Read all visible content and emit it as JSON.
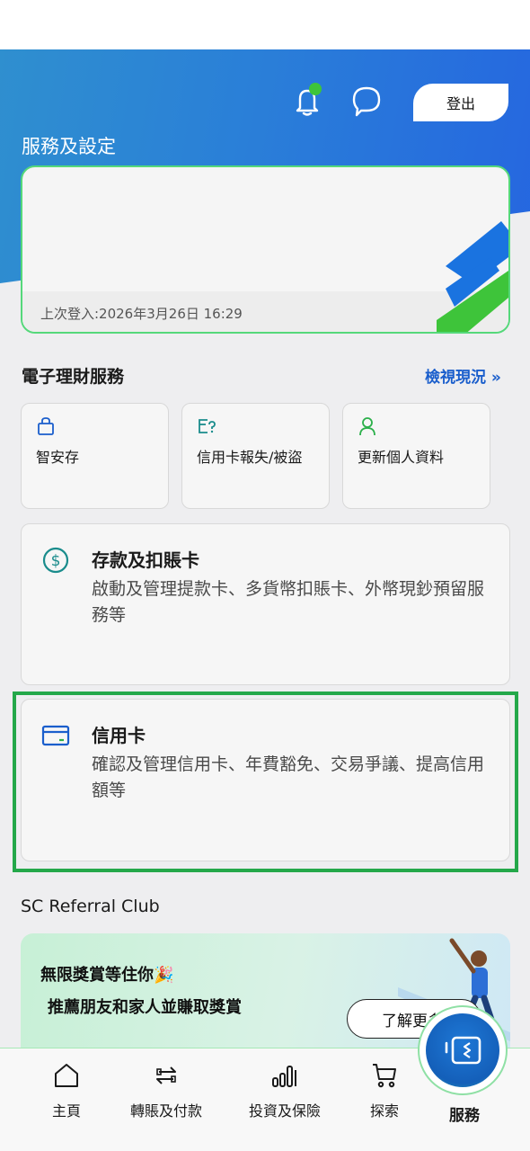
{
  "header": {
    "title": "服務及設定",
    "logout_label": "登出",
    "icons": [
      "bell-icon",
      "chat-icon"
    ]
  },
  "account_card": {
    "last_login": "上次登入:2026年3月26日 16:29"
  },
  "ebanking": {
    "section_title": "電子理財服務",
    "view_link": "檢視現況 »",
    "tiles": [
      {
        "label": "智安存",
        "icon": "lock-bag-icon"
      },
      {
        "label": "信用卡報失/被盜",
        "icon": "card-question-icon"
      },
      {
        "label": "更新個人資料",
        "icon": "person-icon"
      }
    ]
  },
  "services": [
    {
      "title": "存款及扣賬卡",
      "description": "啟動及管理提款卡、多貨幣扣賬卡、外幣現鈔預留服務等",
      "icon": "dollar-circle-icon"
    },
    {
      "title": "信用卡",
      "description": "確認及管理信用卡、年費豁免、交易爭議、提高信用額等",
      "icon": "credit-card-icon"
    }
  ],
  "referral": {
    "section_title": "SC Referral Club",
    "promo_line1": "無限獎賞等住你🎉",
    "promo_line2": "推薦朋友和家人並賺取獎賞",
    "button_label": "了解更多"
  },
  "bottom_nav": {
    "items": [
      {
        "label": "主頁",
        "icon": "home-icon"
      },
      {
        "label": "轉賬及付款",
        "icon": "transfer-icon"
      },
      {
        "label": "投資及保險",
        "icon": "bar-chart-icon"
      },
      {
        "label": "探索",
        "icon": "cart-icon"
      }
    ],
    "active_label": "服務",
    "active_icon": "service-card-icon"
  },
  "colors": {
    "accent_blue": "#1a5ecc",
    "brand_green": "#3ec43a",
    "highlight_green": "#24a84a"
  }
}
